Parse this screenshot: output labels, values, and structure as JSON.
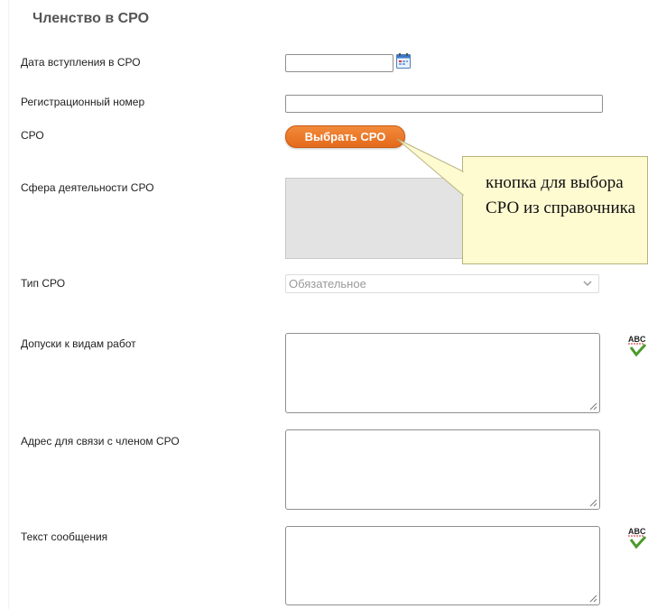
{
  "section": {
    "title": "Членство в СРО"
  },
  "fields": {
    "entry_date": {
      "label": "Дата вступления в СРО",
      "value": ""
    },
    "reg_number": {
      "label": "Регистрационный номер",
      "value": ""
    },
    "sro": {
      "label": "СРО",
      "button_label": "Выбрать СРО"
    },
    "sphere": {
      "label": "Сфера деятельности СРО"
    },
    "sro_type": {
      "label": "Тип СРО",
      "selected": "Обязательное"
    },
    "permits": {
      "label": "Допуски к видам работ",
      "value": ""
    },
    "address": {
      "label": "Адрес для связи с членом СРО",
      "value": ""
    },
    "message": {
      "label": "Текст сообщения",
      "value": ""
    }
  },
  "callout": {
    "text": "кнопка для выбора СРО из справочника"
  },
  "icons": {
    "calendar": "calendar-icon",
    "spellcheck": "spellcheck-icon",
    "chevron": "chevron-down-icon",
    "resize": "resize-grip-icon"
  },
  "colors": {
    "accent_button": "#e8701f",
    "callout_bg": "#fffbd1",
    "disabled_bg": "#e3e3e3"
  }
}
